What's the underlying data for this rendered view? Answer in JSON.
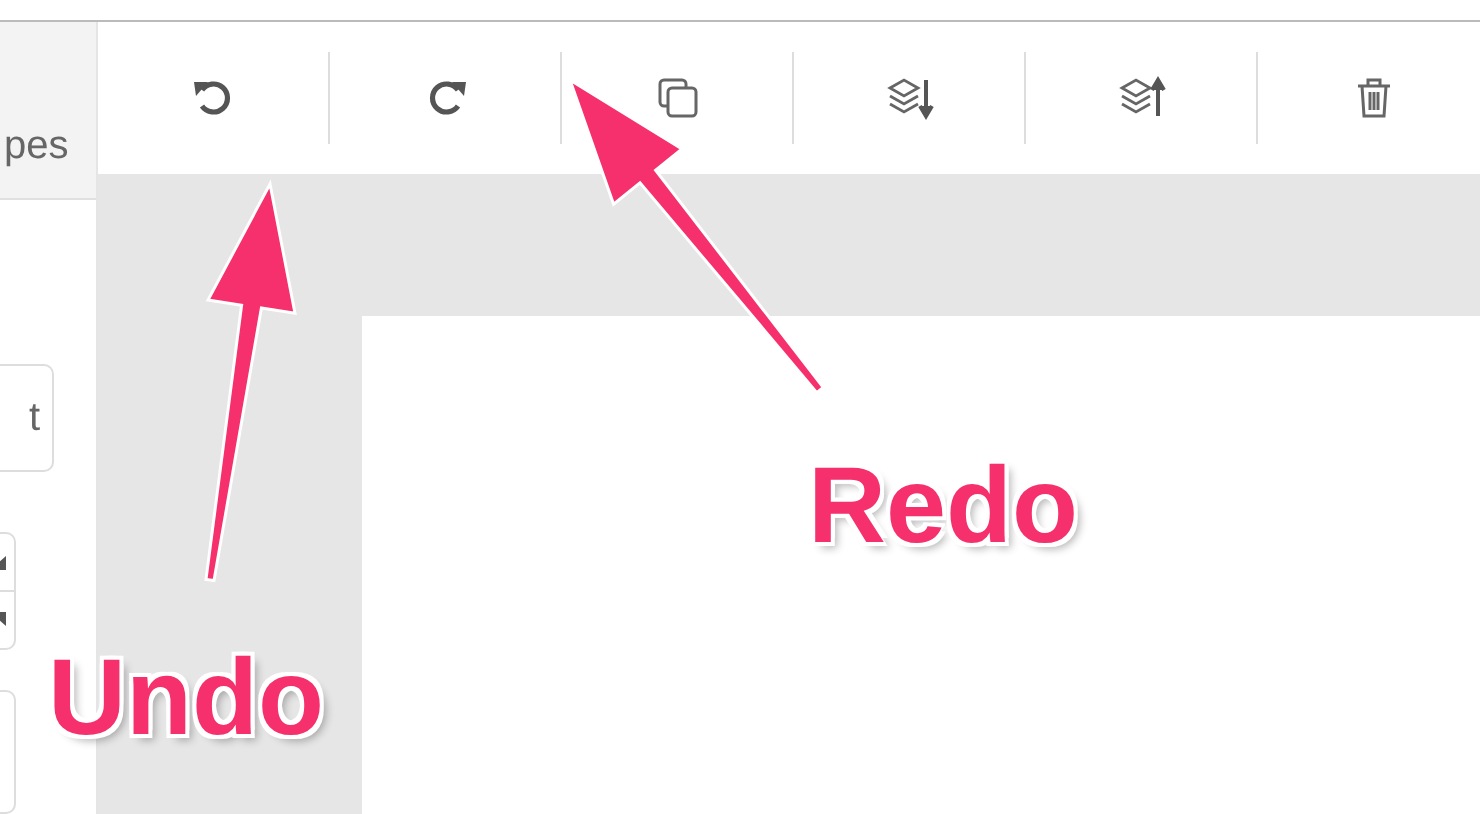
{
  "sidebar": {
    "shapes_label": "pes",
    "text_field": "t"
  },
  "toolbar": {
    "buttons": [
      {
        "kind": "undo"
      },
      {
        "kind": "redo"
      },
      {
        "kind": "duplicate"
      },
      {
        "kind": "send-back"
      },
      {
        "kind": "bring-front"
      },
      {
        "kind": "delete"
      }
    ]
  },
  "annotations": [
    {
      "label": "Undo"
    },
    {
      "label": "Redo"
    }
  ]
}
